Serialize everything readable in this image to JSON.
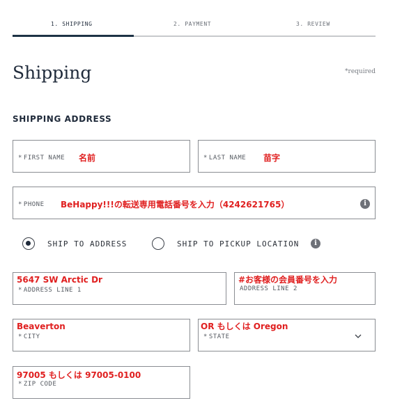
{
  "steps": [
    {
      "label": "1. SHIPPING",
      "active": true
    },
    {
      "label": "2. PAYMENT",
      "active": false
    },
    {
      "label": "3. REVIEW",
      "active": false
    }
  ],
  "page_title": "Shipping",
  "required_note": "*required",
  "section_title": "SHIPPING ADDRESS",
  "required_mark": "*",
  "fields": {
    "first_name": {
      "label": "FIRST NAME",
      "value": "名前"
    },
    "last_name": {
      "label": "LAST NAME",
      "value": "苗字"
    },
    "phone": {
      "label": "PHONE",
      "value": "BeHappy!!!の転送専用電話番号を入力（4242621765）"
    },
    "address_line_1": {
      "label": "ADDRESS LINE 1",
      "value": "5647 SW Arctic Dr"
    },
    "address_line_2": {
      "label": "ADDRESS LINE 2",
      "value": "#お客様の会員番号を入力"
    },
    "city": {
      "label": "CITY",
      "value": "Beaverton"
    },
    "state": {
      "label": "STATE",
      "value": "OR もしくは Oregon"
    },
    "zip_code": {
      "label": "ZIP CODE",
      "value": "97005 もしくは 97005-0100"
    }
  },
  "delivery_options": [
    {
      "label": "SHIP TO ADDRESS",
      "selected": true
    },
    {
      "label": "SHIP TO PICKUP LOCATION",
      "selected": false
    }
  ],
  "icons": {
    "info": "info-icon",
    "info_glyph": "i",
    "state_dropdown": "chevron-down-icon"
  },
  "colors": {
    "accent": "#1d3245",
    "annotation": "#e02020",
    "border": "#8a8d92"
  }
}
